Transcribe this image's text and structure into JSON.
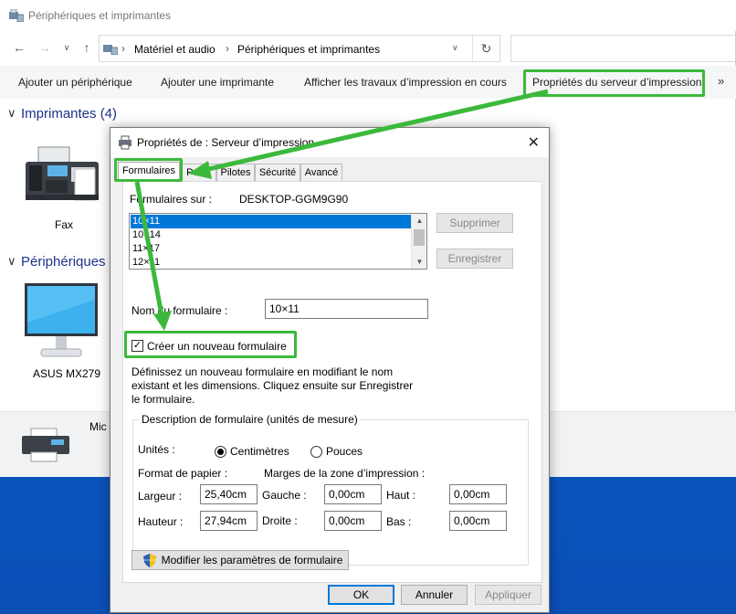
{
  "explorer": {
    "title": "Périphériques et imprimantes",
    "breadcrumb": [
      "Matériel et audio",
      "Périphériques et imprimantes"
    ],
    "commands": [
      "Ajouter un périphérique",
      "Ajouter une imprimante",
      "Afficher les travaux d’impression en cours",
      "Propriétés du serveur d’impression"
    ],
    "more": "»",
    "groups": {
      "printers": "Imprimantes (4)",
      "devices": "Périphériques ("
    },
    "devices": {
      "fax": "Fax",
      "monitor": "ASUS MX279",
      "bottom_partial": "Mic"
    }
  },
  "dialog": {
    "title": "Propriétés de : Serveur d’impression",
    "tabs": [
      "Formulaires",
      "Ports",
      "Pilotes",
      "Sécurité",
      "Avancé"
    ],
    "forms_on_label": "Formulaires sur :",
    "computer_name": "DESKTOP-GGM9G90",
    "form_list": [
      "10×11",
      "10×14",
      "11×17",
      "12×11"
    ],
    "delete_button": "Supprimer",
    "save_button": "Enregistrer",
    "form_name_label": "Nom du formulaire :",
    "form_name_value": "10×11",
    "new_form_checkbox": "Créer un nouveau formulaire",
    "new_form_checked": true,
    "description_text": [
      "Définissez un nouveau formulaire en modifiant le nom",
      "existant et les dimensions. Cliquez ensuite sur Enregistrer",
      "le formulaire."
    ],
    "groupbox_title": "Description de formulaire (unités de mesure)",
    "units_label": "Unités :",
    "unit_cm": "Centimètres",
    "unit_in": "Pouces",
    "unit_selected": "Centimètres",
    "paper_format_label": "Format de papier :",
    "margins_label": "Marges de la zone d’impression :",
    "width_label": "Largeur :",
    "width_value": "25,40cm",
    "height_label": "Hauteur :",
    "height_value": "27,94cm",
    "left_label": "Gauche :",
    "left_value": "0,00cm",
    "right_label": "Droite :",
    "right_value": "0,00cm",
    "top_label": "Haut :",
    "top_value": "0,00cm",
    "bottom_label": "Bas :",
    "bottom_value": "0,00cm",
    "change_settings_button": "Modifier les paramètres de formulaire",
    "ok_button": "OK",
    "cancel_button": "Annuler",
    "apply_button": "Appliquer"
  },
  "colors": {
    "highlight": "#3cb93c",
    "selection": "#0078d7",
    "group_header": "#1e3287"
  }
}
